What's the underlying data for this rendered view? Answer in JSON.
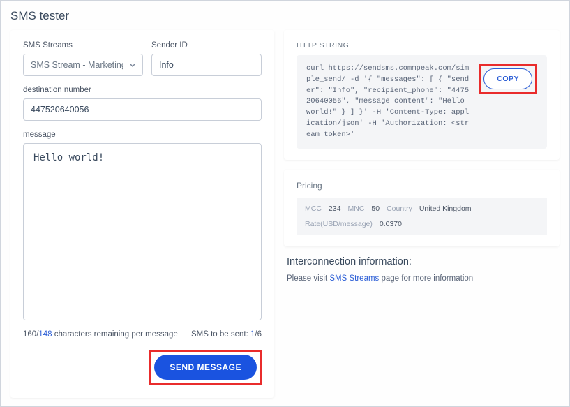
{
  "title": "SMS tester",
  "form": {
    "streams_label": "SMS Streams",
    "streams_value": "SMS Stream - Marketing",
    "sender_label": "Sender ID",
    "sender_value": "Info",
    "dest_label": "destination number",
    "dest_value": "447520640056",
    "msg_label": "message",
    "msg_value": "Hello world!"
  },
  "counter": {
    "max": "160",
    "remaining": "148",
    "suffix": " characters remaining per message",
    "sent_prefix": "SMS to be sent: ",
    "sent_cur": "1",
    "sent_total": "6"
  },
  "send_button": "SEND MESSAGE",
  "http": {
    "label": "HTTP STRING",
    "code": "curl https://sendsms.commpeak.com/simple_send/ -d '{ \"messages\": [ { \"sender\": \"Info\", \"recipient_phone\": \"447520640056\", \"message_content\": \"Hello world!\" } ] }' -H 'Content-Type: application/json' -H 'Authorization: <stream token>'",
    "copy": "COPY"
  },
  "pricing": {
    "label": "Pricing",
    "mcc_k": "MCC",
    "mcc_v": "234",
    "mnc_k": "MNC",
    "mnc_v": "50",
    "country_k": "Country",
    "country_v": "United Kingdom",
    "rate_k": "Rate(USD/message)",
    "rate_v": "0.0370"
  },
  "inter": {
    "title": "Interconnection information:",
    "prefix": "Please visit ",
    "link": "SMS Streams",
    "suffix": " page for more information"
  }
}
